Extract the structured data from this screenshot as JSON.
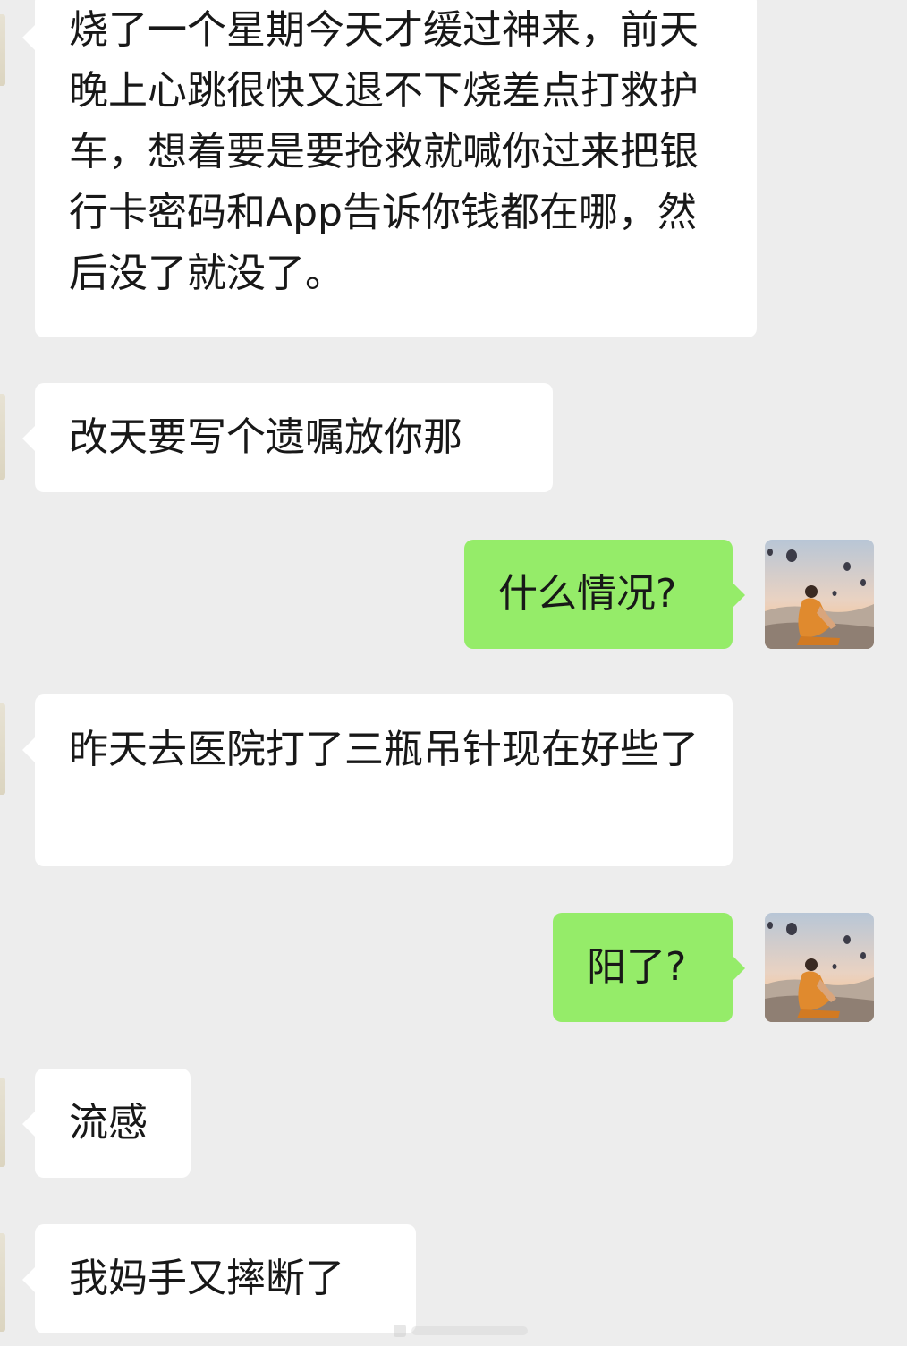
{
  "messages": [
    {
      "side": "incoming",
      "text": "烧了一个星期今天才缓过神来，前天晚上心跳很快又退不下烧差点打救护车，想着要是要抢救就喊你过来把银行卡密码和App告诉你钱都在哪，然后没了就没了。"
    },
    {
      "side": "incoming",
      "text": "改天要写个遗嘱放你那"
    },
    {
      "side": "outgoing",
      "text": "什么情况?"
    },
    {
      "side": "incoming",
      "text": "昨天去医院打了三瓶吊针现在好些了"
    },
    {
      "side": "outgoing",
      "text": "阳了?"
    },
    {
      "side": "incoming",
      "text": "流感"
    },
    {
      "side": "incoming",
      "text": "我妈手又摔断了"
    }
  ],
  "colors": {
    "background": "#ededed",
    "incoming_bubble": "#ffffff",
    "outgoing_bubble": "#95ec69",
    "text": "#181818"
  },
  "icons": {
    "own_avatar": "avatar-photo-balloons-sunset"
  }
}
